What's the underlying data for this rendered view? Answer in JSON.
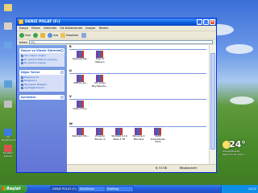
{
  "window": {
    "title": "DENIZ POLAT (F:)",
    "menu": [
      "Dosya",
      "Düzen",
      "Görünüm",
      "Sık Kullanılanlar",
      "Araçlar",
      "Yardım"
    ],
    "toolbar": {
      "back": "Geri",
      "search": "Ara",
      "folders": "Klasörler"
    },
    "address_label": "Adres",
    "address_value": "F:\\"
  },
  "left_panels": [
    {
      "title": "Dosya ve Klasör Görevleri",
      "items": [
        "Yeni klasör oluştur",
        "Bu klasörü Web'de yayımla",
        "Bu klasörü paylaş"
      ]
    },
    {
      "title": "Diğer Yerler",
      "items": [
        "Bilgisayarım",
        "Belgelerim",
        "Paylaşılan Belgeler",
        "Ağ Bağlantılarım"
      ]
    },
    {
      "title": "Ayrıntılar",
      "items": []
    }
  ],
  "groups": [
    {
      "letter": "R",
      "files": [
        "Razovar-My...",
        "Rise of Nations"
      ]
    },
    {
      "letter": "U",
      "files": [
        "UHBYC_02...",
        "Ulti Koley Büyüklerde..."
      ]
    },
    {
      "letter": "V",
      "files": [
        "Video Conv..."
      ]
    },
    {
      "letter": "W",
      "files": [
        "Webcam Mo...",
        "Winamp Eleven X",
        "WinRAR 4.10 Beta 3 TR",
        "Winamp 4 Machine",
        "WWE SmackDown 2011"
      ]
    }
  ],
  "status": {
    "size": "6,74 GB",
    "location": "Bilgisayarım"
  },
  "desktop_icons": [
    "",
    "",
    "",
    "",
    "",
    "Ağ Bağlantılarım",
    "Denetim Masası"
  ],
  "widget": {
    "temp": "24°",
    "city": "Adana/Merkez",
    "date": "Pazar 01.07.2011"
  },
  "taskbar": {
    "start": "Başlat",
    "tasks": [
      "DENIZ POLAT (F:)",
      "DinkShots",
      "Drafting"
    ],
    "clock": "14:22"
  }
}
